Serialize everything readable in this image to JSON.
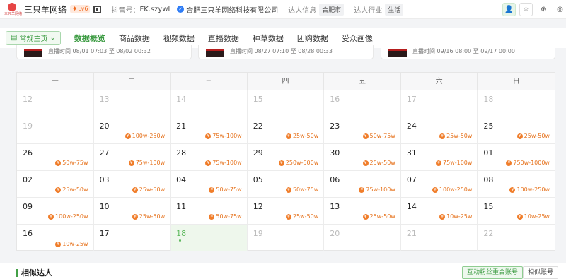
{
  "header": {
    "account_name": "三只羊网络",
    "logo_text": "三只羊网络",
    "level": "Lv6",
    "douyin_label": "抖音号：",
    "douyin_id": "FK.szywl",
    "company": "合肥三只羊网络科技有限公司",
    "info_label": "达人信息",
    "info_tag": "合肥市",
    "industry_label": "达人行业",
    "industry_tag": "生活"
  },
  "nav": {
    "home": "常规主页",
    "tabs": [
      "数据概览",
      "商品数据",
      "视频数据",
      "直播数据",
      "种草数据",
      "团购数据",
      "受众画像"
    ],
    "active_tab": 0
  },
  "live_cards": [
    "直播时间 08/01 07:03 至 08/02 00:32",
    "直播时间 08/27 07:10 至 08/28 00:33",
    "直播时间 09/16 08:00 至 09/17 00:00"
  ],
  "calendar": {
    "weekdays": [
      "一",
      "二",
      "三",
      "四",
      "五",
      "六",
      "日"
    ],
    "days": [
      {
        "d": "12",
        "dim": true,
        "r": ""
      },
      {
        "d": "13",
        "dim": true,
        "r": ""
      },
      {
        "d": "14",
        "dim": true,
        "r": ""
      },
      {
        "d": "15",
        "dim": true,
        "r": ""
      },
      {
        "d": "16",
        "dim": true,
        "r": ""
      },
      {
        "d": "17",
        "dim": true,
        "r": ""
      },
      {
        "d": "18",
        "dim": true,
        "r": ""
      },
      {
        "d": "19",
        "dim": true,
        "r": ""
      },
      {
        "d": "20",
        "dim": false,
        "r": "100w-250w"
      },
      {
        "d": "21",
        "dim": false,
        "r": "75w-100w"
      },
      {
        "d": "22",
        "dim": false,
        "r": "25w-50w"
      },
      {
        "d": "23",
        "dim": false,
        "r": "50w-75w"
      },
      {
        "d": "24",
        "dim": false,
        "r": "25w-50w"
      },
      {
        "d": "25",
        "dim": false,
        "r": "25w-50w"
      },
      {
        "d": "26",
        "dim": false,
        "r": "50w-75w"
      },
      {
        "d": "27",
        "dim": false,
        "r": "75w-100w"
      },
      {
        "d": "28",
        "dim": false,
        "r": "75w-100w"
      },
      {
        "d": "29",
        "dim": false,
        "r": "250w-500w"
      },
      {
        "d": "30",
        "dim": false,
        "r": "25w-50w"
      },
      {
        "d": "31",
        "dim": false,
        "r": "75w-100w"
      },
      {
        "d": "01",
        "dim": false,
        "r": "750w-1000w"
      },
      {
        "d": "02",
        "dim": false,
        "r": "25w-50w"
      },
      {
        "d": "03",
        "dim": false,
        "r": "25w-50w"
      },
      {
        "d": "04",
        "dim": false,
        "r": "50w-75w"
      },
      {
        "d": "05",
        "dim": false,
        "r": "50w-75w"
      },
      {
        "d": "06",
        "dim": false,
        "r": "75w-100w"
      },
      {
        "d": "07",
        "dim": false,
        "r": "100w-250w"
      },
      {
        "d": "08",
        "dim": false,
        "r": "100w-250w"
      },
      {
        "d": "09",
        "dim": false,
        "r": "100w-250w"
      },
      {
        "d": "10",
        "dim": false,
        "r": "25w-50w"
      },
      {
        "d": "11",
        "dim": false,
        "r": "50w-75w"
      },
      {
        "d": "12",
        "dim": false,
        "r": "25w-50w"
      },
      {
        "d": "13",
        "dim": false,
        "r": "25w-50w"
      },
      {
        "d": "14",
        "dim": false,
        "r": "10w-25w"
      },
      {
        "d": "15",
        "dim": false,
        "r": "10w-25w"
      },
      {
        "d": "16",
        "dim": false,
        "r": "10w-25w"
      },
      {
        "d": "17",
        "dim": false,
        "r": ""
      },
      {
        "d": "18",
        "dim": false,
        "today": true,
        "r": ""
      },
      {
        "d": "19",
        "dim": true,
        "r": ""
      },
      {
        "d": "20",
        "dim": true,
        "r": ""
      },
      {
        "d": "21",
        "dim": true,
        "r": ""
      },
      {
        "d": "22",
        "dim": true,
        "r": ""
      }
    ]
  },
  "similar": {
    "title": "相似达人",
    "btn_overlap": "互动粉丝重合账号",
    "btn_similar": "相似账号"
  },
  "icons": {
    "follow": "add-user-icon",
    "star": "star-icon",
    "add": "plus-circle-icon",
    "more": "more-icon"
  },
  "colors": {
    "accent": "#3c9b42",
    "range": "#e6731e"
  }
}
